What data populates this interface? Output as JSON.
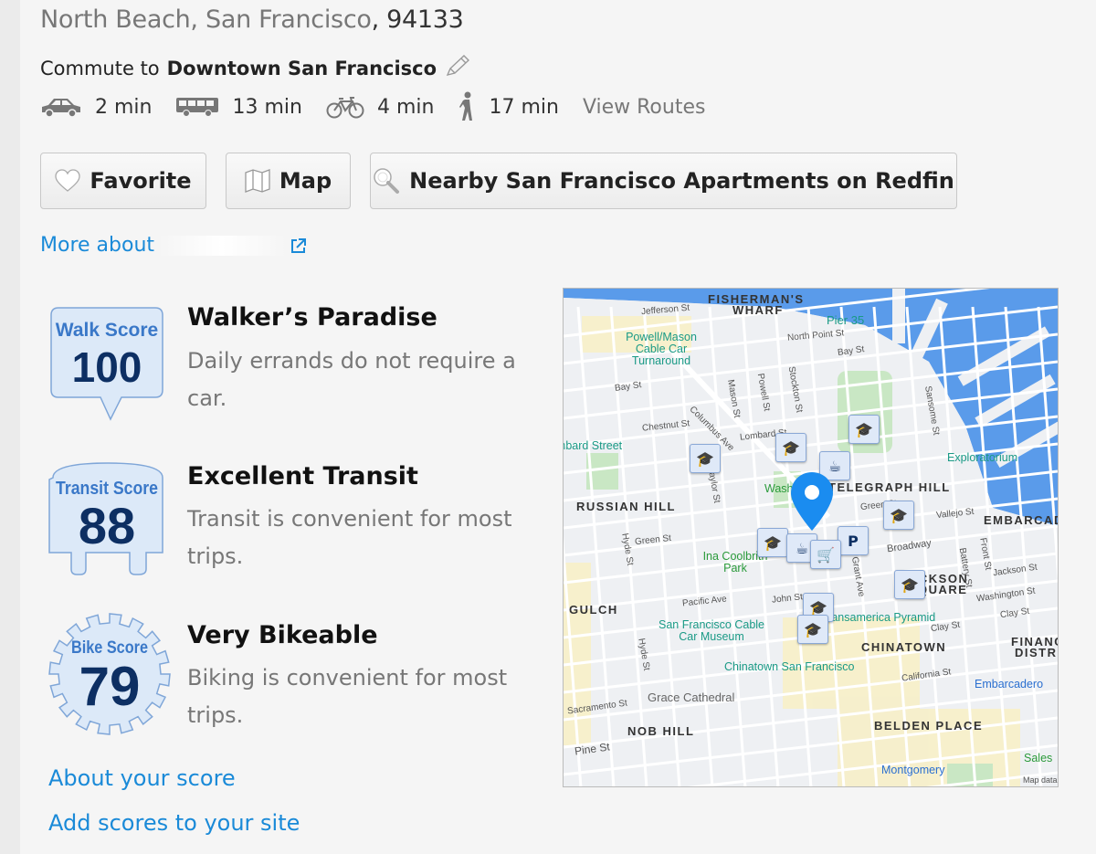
{
  "header": {
    "address": "North Beach, San Francisco",
    "zip": ", 94133",
    "commute_prefix": "Commute to",
    "commute_destination": "Downtown San Francisco",
    "edit_icon": "pencil-icon"
  },
  "commute_modes": [
    {
      "icon": "car-icon",
      "time": "2 min"
    },
    {
      "icon": "bus-icon",
      "time": "13 min"
    },
    {
      "icon": "bike-icon",
      "time": "4 min"
    },
    {
      "icon": "walk-icon",
      "time": "17 min"
    }
  ],
  "view_routes": "View Routes",
  "buttons": {
    "favorite": "Favorite",
    "map": "Map",
    "nearby": "Nearby San Francisco Apartments on Redfin"
  },
  "more_about": "More about",
  "scores": [
    {
      "label": "Walk Score",
      "value": "100",
      "title": "Walker’s Paradise",
      "desc": "Daily errands do not require a car."
    },
    {
      "label": "Transit Score",
      "value": "88",
      "title": "Excellent Transit",
      "desc": "Transit is convenient for most trips."
    },
    {
      "label": "Bike Score",
      "value": "79",
      "title": "Very Bikeable",
      "desc": "Biking is convenient for most trips."
    }
  ],
  "links": {
    "about_score": "About your score",
    "add_scores": "Add scores to your site"
  },
  "map": {
    "neighborhoods": [
      "FISHERMAN'S",
      "WHARF",
      "TELEGRAPH HILL",
      "RUSSIAN HILL",
      "EMBARCAD",
      "ACKSON",
      "QUARE",
      "GULCH",
      "CHINATOWN",
      "FINANC",
      "DISTRI",
      "NOB HILL",
      "BELDEN PLACE"
    ],
    "streets": [
      "Jefferson St",
      "North Point St",
      "Bay St",
      "Bay St",
      "Chestnut St",
      "Lombard St",
      "Columbus Ave",
      "Mason St",
      "Powell St",
      "Stockton St",
      "Sansome St",
      "Green St",
      "Green St",
      "Broadway",
      "Hyde St",
      "Taylor St",
      "Pacific Ave",
      "John St",
      "Grant Ave",
      "Battery St",
      "Front St",
      "Jackson St",
      "Washington St",
      "Clay St",
      "Clay St",
      "California St",
      "Hyde St",
      "Sacramento St",
      "Pine St",
      "Vallejo St"
    ],
    "pois": [
      "Powell/Mason Cable Car Turnaround",
      "Pier 35",
      "Exploratorium",
      "Ina Coolbrith Park",
      "San Francisco Cable Car Museum",
      "Transamerica Pyramid",
      "Chinatown San Francisco",
      "Grace Cathedral",
      "Embarcadero",
      "Montgomery",
      "Sales",
      "Map data",
      "Lombard Street",
      "Washington Sq"
    ],
    "colors": {
      "water": "#5a9bea",
      "land": "#eef0f3",
      "park": "#c9e7c4",
      "block": "#f7efc8",
      "pin": "#1a8cf0",
      "marker": "#0d2f63"
    },
    "markers": [
      "school-icon",
      "school-icon",
      "school-icon",
      "school-icon",
      "school-icon",
      "school-icon",
      "school-icon",
      "school-icon",
      "coffee-icon",
      "coffee-icon",
      "parking-icon",
      "grocery-cart-icon"
    ]
  }
}
